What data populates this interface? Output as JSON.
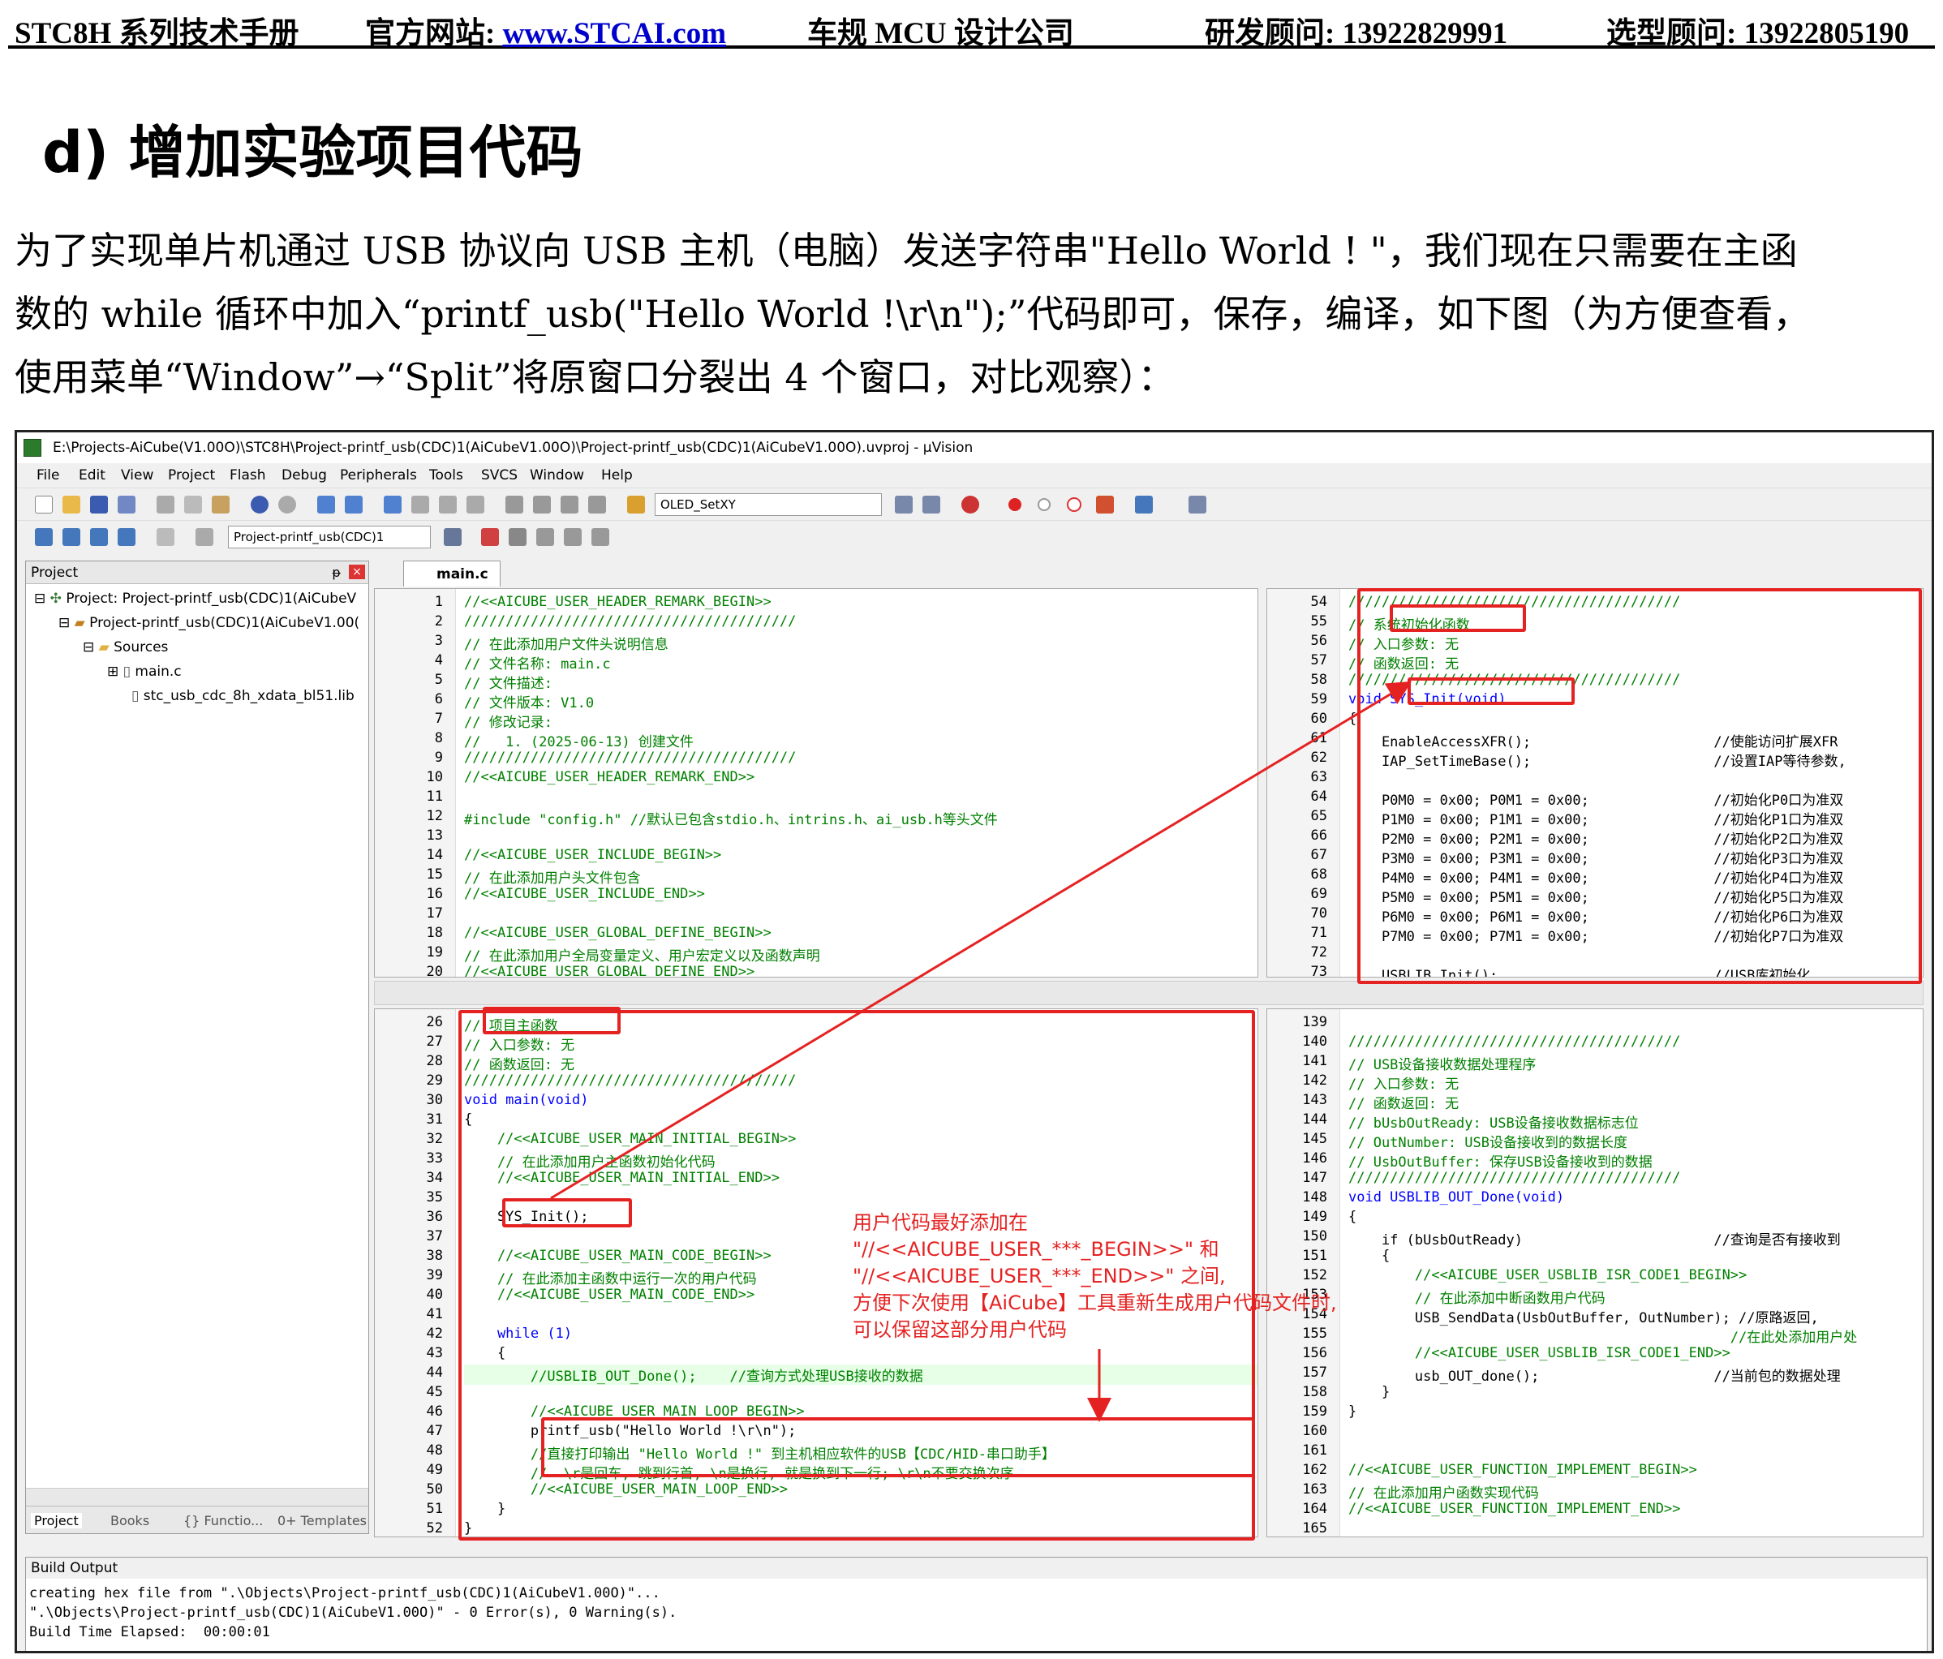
{
  "header": {
    "manual": "STC8H 系列技术手册",
    "site_label": "官方网站: ",
    "site_url": "www.STCAI.com",
    "company": "车规 MCU 设计公司",
    "rd": "研发顾问: 13922829991",
    "sel": "选型顾问: 13922805190"
  },
  "section_title": "d)  增加实验项目代码",
  "paragraph": [
    "为了实现单片机通过 USB 协议向 USB 主机（电脑）发送字符串\"Hello World ! \"，我们现在只需要在主函",
    "数的 while 循环中加入“printf_usb(\"Hello World !\\r\\n\");”代码即可，保存，编译，如下图（为方便查看，",
    "使用菜单“Window”→“Split”将原窗口分裂出 4 个窗口，对比观察）："
  ],
  "window": {
    "title": "E:\\Projects-AiCube(V1.00O)\\STC8H\\Project-printf_usb(CDC)1(AiCubeV1.00O)\\Project-printf_usb(CDC)1(AiCubeV1.00O).uvproj - µVision",
    "menu": [
      "File",
      "Edit",
      "View",
      "Project",
      "Flash",
      "Debug",
      "Peripherals",
      "Tools",
      "SVCS",
      "Window",
      "Help"
    ],
    "toolbar1_combo": "OLED_SetXY",
    "toolbar2_combo": "Project-printf_usb(CDC)1"
  },
  "project_panel": {
    "title": "Project",
    "tree": [
      "Project: Project-printf_usb(CDC)1(AiCubeV",
      "Project-printf_usb(CDC)1(AiCubeV1.00(",
      "Sources",
      "main.c",
      "stc_usb_cdc_8h_xdata_bl51.lib"
    ],
    "tabs": [
      "Project",
      "Books",
      "{} Functio...",
      "0+ Templates"
    ]
  },
  "editor_tab": "main.c",
  "pane_tl": [
    {
      "n": "1",
      "t": "//<<AICUBE_USER_HEADER_REMARK_BEGIN>>",
      "c": "cmt"
    },
    {
      "n": "2",
      "t": "////////////////////////////////////////",
      "c": "cmt"
    },
    {
      "n": "3",
      "t": "// 在此添加用户文件头说明信息",
      "c": "cmt"
    },
    {
      "n": "4",
      "t": "// 文件名称: main.c",
      "c": "cmt"
    },
    {
      "n": "5",
      "t": "// 文件描述:",
      "c": "cmt"
    },
    {
      "n": "6",
      "t": "// 文件版本: V1.0",
      "c": "cmt"
    },
    {
      "n": "7",
      "t": "// 修改记录:",
      "c": "cmt"
    },
    {
      "n": "8",
      "t": "//   1. (2025-06-13) 创建文件",
      "c": "cmt"
    },
    {
      "n": "9",
      "t": "////////////////////////////////////////",
      "c": "cmt"
    },
    {
      "n": "10",
      "t": "//<<AICUBE_USER_HEADER_REMARK_END>>",
      "c": "cmt"
    },
    {
      "n": "11",
      "t": "",
      "c": ""
    },
    {
      "n": "12",
      "t": "#include \"config.h\" //默认已包含stdio.h、intrins.h、ai_usb.h等头文件",
      "c": "cmt"
    },
    {
      "n": "13",
      "t": "",
      "c": ""
    },
    {
      "n": "14",
      "t": "//<<AICUBE_USER_INCLUDE_BEGIN>>",
      "c": "cmt"
    },
    {
      "n": "15",
      "t": "// 在此添加用户头文件包含",
      "c": "cmt"
    },
    {
      "n": "16",
      "t": "//<<AICUBE_USER_INCLUDE_END>>",
      "c": "cmt"
    },
    {
      "n": "17",
      "t": "",
      "c": ""
    },
    {
      "n": "18",
      "t": "//<<AICUBE_USER_GLOBAL_DEFINE_BEGIN>>",
      "c": "cmt"
    },
    {
      "n": "19",
      "t": "// 在此添加用户全局变量定义、用户宏定义以及函数声明",
      "c": "cmt"
    },
    {
      "n": "20",
      "t": "//<<AICUBE_USER_GLOBAL_DEFINE_END>>",
      "c": "cmt"
    }
  ],
  "pane_tr": [
    {
      "n": "54",
      "t": "////////////////////////////////////////",
      "c": "cmt"
    },
    {
      "n": "55",
      "t": "// 系统初始化函数",
      "c": "cmt"
    },
    {
      "n": "56",
      "t": "// 入口参数: 无",
      "c": "cmt"
    },
    {
      "n": "57",
      "t": "// 函数返回: 无",
      "c": "cmt"
    },
    {
      "n": "58",
      "t": "////////////////////////////////////////",
      "c": "cmt"
    },
    {
      "n": "59",
      "t": "void SYS_Init(void)",
      "c": "kw"
    },
    {
      "n": "60",
      "t": "{",
      "c": ""
    },
    {
      "n": "61",
      "t": "    EnableAccessXFR();                      //使能访问扩展XFR",
      "c": ""
    },
    {
      "n": "62",
      "t": "    IAP_SetTimeBase();                      //设置IAP等待参数,",
      "c": ""
    },
    {
      "n": "63",
      "t": "",
      "c": ""
    },
    {
      "n": "64",
      "t": "    P0M0 = 0x00; P0M1 = 0x00;               //初始化P0口为准双",
      "c": ""
    },
    {
      "n": "65",
      "t": "    P1M0 = 0x00; P1M1 = 0x00;               //初始化P1口为准双",
      "c": ""
    },
    {
      "n": "66",
      "t": "    P2M0 = 0x00; P2M1 = 0x00;               //初始化P2口为准双",
      "c": ""
    },
    {
      "n": "67",
      "t": "    P3M0 = 0x00; P3M1 = 0x00;               //初始化P3口为准双",
      "c": ""
    },
    {
      "n": "68",
      "t": "    P4M0 = 0x00; P4M1 = 0x00;               //初始化P4口为准双",
      "c": ""
    },
    {
      "n": "69",
      "t": "    P5M0 = 0x00; P5M1 = 0x00;               //初始化P5口为准双",
      "c": ""
    },
    {
      "n": "70",
      "t": "    P6M0 = 0x00; P6M1 = 0x00;               //初始化P6口为准双",
      "c": ""
    },
    {
      "n": "71",
      "t": "    P7M0 = 0x00; P7M1 = 0x00;               //初始化P7口为准双",
      "c": ""
    },
    {
      "n": "72",
      "t": "",
      "c": ""
    },
    {
      "n": "73",
      "t": "    USBLIB_Init();                          //USB库初始化",
      "c": ""
    }
  ],
  "pane_bl": [
    {
      "n": "26",
      "t": "// 项目主函数",
      "c": "cmt"
    },
    {
      "n": "27",
      "t": "// 入口参数: 无",
      "c": "cmt"
    },
    {
      "n": "28",
      "t": "// 函数返回: 无",
      "c": "cmt"
    },
    {
      "n": "29",
      "t": "////////////////////////////////////////",
      "c": "cmt"
    },
    {
      "n": "30",
      "t": "void main(void)",
      "c": "kw"
    },
    {
      "n": "31",
      "t": "{",
      "c": ""
    },
    {
      "n": "32",
      "t": "    //<<AICUBE_USER_MAIN_INITIAL_BEGIN>>",
      "c": "cmt"
    },
    {
      "n": "33",
      "t": "    // 在此添加用户主函数初始化代码",
      "c": "cmt"
    },
    {
      "n": "34",
      "t": "    //<<AICUBE_USER_MAIN_INITIAL_END>>",
      "c": "cmt"
    },
    {
      "n": "35",
      "t": "",
      "c": ""
    },
    {
      "n": "36",
      "t": "    SYS_Init();",
      "c": ""
    },
    {
      "n": "37",
      "t": "",
      "c": ""
    },
    {
      "n": "38",
      "t": "    //<<AICUBE_USER_MAIN_CODE_BEGIN>>",
      "c": "cmt"
    },
    {
      "n": "39",
      "t": "    // 在此添加主函数中运行一次的用户代码",
      "c": "cmt"
    },
    {
      "n": "40",
      "t": "    //<<AICUBE_USER_MAIN_CODE_END>>",
      "c": "cmt"
    },
    {
      "n": "41",
      "t": "",
      "c": ""
    },
    {
      "n": "42",
      "t": "    while (1)",
      "c": "kw"
    },
    {
      "n": "43",
      "t": "    {",
      "c": ""
    },
    {
      "n": "44",
      "t": "        //USBLIB_OUT_Done();    //查询方式处理USB接收的数据",
      "c": "cmt hl"
    },
    {
      "n": "45",
      "t": "",
      "c": ""
    },
    {
      "n": "46",
      "t": "        //<<AICUBE_USER_MAIN_LOOP_BEGIN>>",
      "c": "cmt"
    },
    {
      "n": "47",
      "t": "        printf_usb(\"Hello World !\\r\\n\");",
      "c": ""
    },
    {
      "n": "48",
      "t": "        //直接打印输出 \"Hello World !\" 到主机相应软件的USB【CDC/HID-串口助手】",
      "c": "cmt"
    },
    {
      "n": "49",
      "t": "        //  \\r是回车, 跳到行首, \\n是换行, 就是换到下一行; \\r\\n不要交换次序",
      "c": "cmt"
    },
    {
      "n": "50",
      "t": "        //<<AICUBE_USER_MAIN_LOOP_END>>",
      "c": "cmt"
    },
    {
      "n": "51",
      "t": "    }",
      "c": ""
    },
    {
      "n": "52",
      "t": "}",
      "c": ""
    }
  ],
  "pane_br": [
    {
      "n": "139",
      "t": "",
      "c": ""
    },
    {
      "n": "140",
      "t": "////////////////////////////////////////",
      "c": "cmt"
    },
    {
      "n": "141",
      "t": "// USB设备接收数据处理程序",
      "c": "cmt"
    },
    {
      "n": "142",
      "t": "// 入口参数: 无",
      "c": "cmt"
    },
    {
      "n": "143",
      "t": "// 函数返回: 无",
      "c": "cmt"
    },
    {
      "n": "144",
      "t": "// bUsbOutReady: USB设备接收数据标志位",
      "c": "cmt"
    },
    {
      "n": "145",
      "t": "// OutNumber: USB设备接收到的数据长度",
      "c": "cmt"
    },
    {
      "n": "146",
      "t": "// UsbOutBuffer: 保存USB设备接收到的数据",
      "c": "cmt"
    },
    {
      "n": "147",
      "t": "////////////////////////////////////////",
      "c": "cmt"
    },
    {
      "n": "148",
      "t": "void USBLIB_OUT_Done(void)",
      "c": "kw"
    },
    {
      "n": "149",
      "t": "{",
      "c": ""
    },
    {
      "n": "150",
      "t": "    if (bUsbOutReady)                       //查询是否有接收到",
      "c": ""
    },
    {
      "n": "151",
      "t": "    {",
      "c": ""
    },
    {
      "n": "152",
      "t": "        //<<AICUBE_USER_USBLIB_ISR_CODE1_BEGIN>>",
      "c": "cmt"
    },
    {
      "n": "153",
      "t": "        // 在此添加中断函数用户代码",
      "c": "cmt"
    },
    {
      "n": "154",
      "t": "        USB_SendData(UsbOutBuffer, OutNumber); //原路返回,",
      "c": ""
    },
    {
      "n": "155",
      "t": "                                              //在此处添加用户处",
      "c": "cmt"
    },
    {
      "n": "156",
      "t": "        //<<AICUBE_USER_USBLIB_ISR_CODE1_END>>",
      "c": "cmt"
    },
    {
      "n": "157",
      "t": "        usb_OUT_done();                     //当前包的数据处理",
      "c": ""
    },
    {
      "n": "158",
      "t": "    }",
      "c": ""
    },
    {
      "n": "159",
      "t": "}",
      "c": ""
    },
    {
      "n": "160",
      "t": "",
      "c": ""
    },
    {
      "n": "161",
      "t": "",
      "c": ""
    },
    {
      "n": "162",
      "t": "//<<AICUBE_USER_FUNCTION_IMPLEMENT_BEGIN>>",
      "c": "cmt"
    },
    {
      "n": "163",
      "t": "// 在此添加用户函数实现代码",
      "c": "cmt"
    },
    {
      "n": "164",
      "t": "//<<AICUBE_USER_FUNCTION_IMPLEMENT_END>>",
      "c": "cmt"
    },
    {
      "n": "165",
      "t": "",
      "c": ""
    }
  ],
  "annotation": [
    "用户代码最好添加在",
    "  \"//<<AICUBE_USER_***_BEGIN>>\" 和",
    "  \"//<<AICUBE_USER_***_END>>\" 之间,",
    "方便下次使用【AiCube】工具重新生成用户代码文件时,",
    "可以保留这部分用户代码"
  ],
  "build_output": {
    "title": "Build Output",
    "lines": [
      "creating hex file from \".\\Objects\\Project-printf_usb(CDC)1(AiCubeV1.00O)\"...",
      "\".\\Objects\\Project-printf_usb(CDC)1(AiCubeV1.00O)\" - 0 Error(s), 0 Warning(s).",
      "Build Time Elapsed:  00:00:01"
    ]
  },
  "colors": {
    "annotation_red": "#e52222",
    "comment_green": "#008000",
    "keyword_blue": "#0000ff",
    "link_blue": "#0000cc"
  }
}
